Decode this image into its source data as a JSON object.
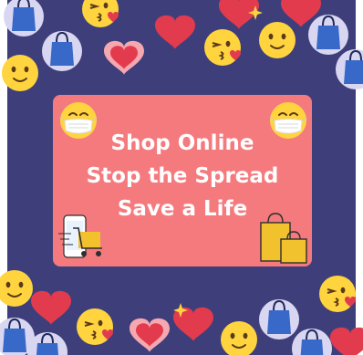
{
  "message": {
    "line1": "Shop Online",
    "line2": "Stop the Spread",
    "line3": "Save a Life"
  },
  "colors": {
    "background": "#3E3F7A",
    "card": "#F47A7E",
    "text": "#FFFFFF",
    "emoji_yellow": "#FFD43F",
    "heart_red": "#E23B4E",
    "bag_blue": "#3868C8"
  }
}
